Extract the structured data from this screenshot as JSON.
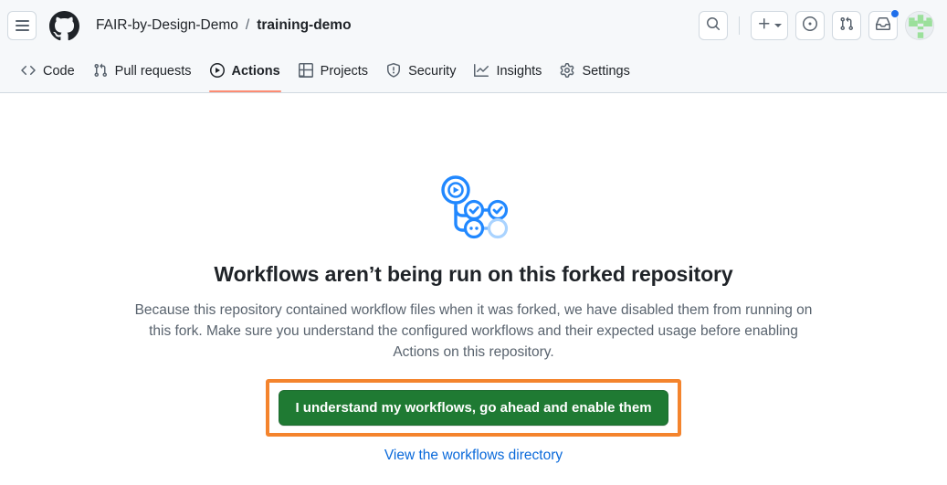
{
  "header": {
    "menu_button": "Open global navigation menu",
    "logo": "github-logo",
    "breadcrumb": {
      "owner": "FAIR-by-Design-Demo",
      "separator": "/",
      "repo": "training-demo"
    },
    "actions": {
      "search": "Search or jump to...",
      "create_new": "Create new...",
      "issues": "Your issues",
      "pull_requests": "Your pull requests",
      "inbox": "Notifications",
      "has_notifications": true,
      "avatar": "Open user account menu"
    }
  },
  "repo_nav": {
    "items": [
      {
        "label": "Code",
        "icon": "code-icon",
        "active": false
      },
      {
        "label": "Pull requests",
        "icon": "git-pull-request-icon",
        "active": false
      },
      {
        "label": "Actions",
        "icon": "play-circle-icon",
        "active": true
      },
      {
        "label": "Projects",
        "icon": "table-icon",
        "active": false
      },
      {
        "label": "Security",
        "icon": "shield-icon",
        "active": false
      },
      {
        "label": "Insights",
        "icon": "graph-icon",
        "active": false
      },
      {
        "label": "Settings",
        "icon": "gear-icon",
        "active": false
      }
    ]
  },
  "main": {
    "illustration": "actions-workflow-icon",
    "heading": "Workflows aren’t being run on this forked repository",
    "body": "Because this repository contained workflow files when it was forked, we have disabled them from running on this fork. Make sure you understand the configured workflows and their expected usage before enabling Actions on this repository.",
    "primary_button": "I understand my workflows, go ahead and enable them",
    "link": "View the workflows directory"
  },
  "colors": {
    "accent_blue": "#0969da",
    "success_green": "#1f7a33",
    "highlight_orange": "#f4842d",
    "active_tab_underline": "#fd8c73",
    "header_bg": "#f6f8fa",
    "border": "#d1d9e0",
    "notification_dot": "#1f6feb"
  }
}
